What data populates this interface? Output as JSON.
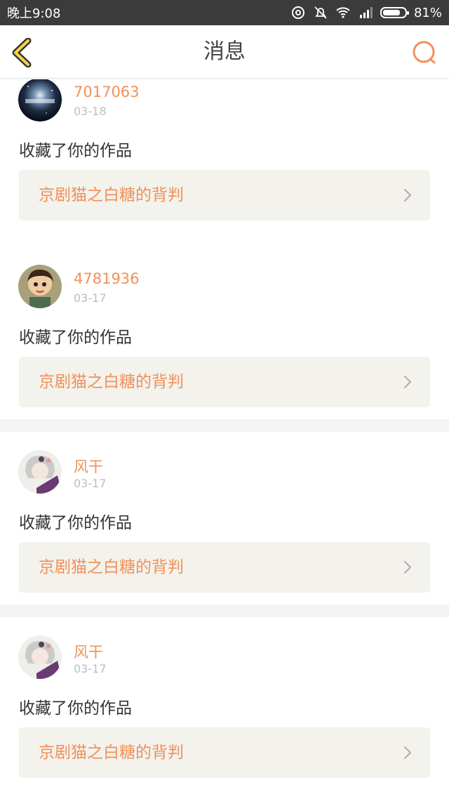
{
  "status_bar": {
    "time": "晚上9:08",
    "battery": "81%",
    "battery_level": 0.81,
    "icons": [
      "sync-icon",
      "bell-muted-icon",
      "wifi-icon",
      "signal-icon",
      "battery-icon"
    ]
  },
  "header": {
    "title": "消息",
    "back_icon": "chevron-left-icon",
    "search_icon": "search-icon",
    "accent_color": "#f0915a"
  },
  "messages": [
    {
      "username": "7017063",
      "date": "03-18",
      "action": "收藏了你的作品",
      "work_title": "京剧猫之白糖的背判",
      "avatar_icon": "galaxy-avatar"
    },
    {
      "username": "4781936",
      "date": "03-17",
      "action": "收藏了你的作品",
      "work_title": "京剧猫之白糖的背判",
      "avatar_icon": "cartoon-boy-avatar"
    },
    {
      "username": "风干",
      "date": "03-17",
      "action": "收藏了你的作品",
      "work_title": "京剧猫之白糖的背判",
      "avatar_icon": "anime-girl-avatar"
    },
    {
      "username": "风干",
      "date": "03-17",
      "action": "收藏了你的作品",
      "work_title": "京剧猫之白糖的背判",
      "avatar_icon": "anime-girl-avatar"
    }
  ]
}
